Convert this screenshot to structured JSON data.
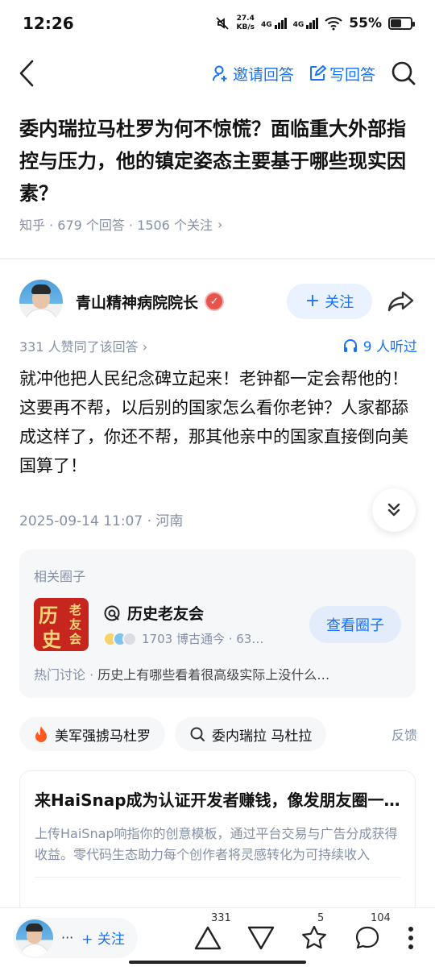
{
  "status": {
    "time": "12:26",
    "speed_value": "27.4",
    "speed_unit": "KB/s",
    "net1": "4G",
    "net2": "4G",
    "battery": "55%",
    "battery_level": 0.55
  },
  "nav": {
    "invite_label": "邀请回答",
    "write_label": "写回答"
  },
  "question": {
    "title": "委内瑞拉马杜罗为何不惊慌？面临重大外部指控与压力，他的镇定姿态主要基于哪些现实因素？",
    "meta": "知乎 · 679 个回答 · 1506 个关注",
    "meta_arrow": "›"
  },
  "author": {
    "name": "青山精神病院院长",
    "follow_label": "关注",
    "agree_text": "331 人赞同了该回答",
    "agree_arrow": "›",
    "listened": "9 人听过"
  },
  "answer": {
    "text": "就冲他把人民纪念碑立起来！老钟都一定会帮他的！这要再不帮，以后别的国家怎么看你老钟？人家都舔成这样了，你还不帮，那其他亲中的国家直接倒向美国算了！",
    "meta": "2025-09-14 11:07 · 河南"
  },
  "circle": {
    "heading": "相关圈子",
    "name": "历史老友会",
    "members": "1703 博古通今 · 63…",
    "view_label": "查看圈子",
    "hot_label": "热门讨论 · ",
    "hot_text": "历史上有哪些看着很高级实际上没什么…",
    "logo_chars": [
      "历",
      "史",
      "老",
      "友",
      "会"
    ]
  },
  "tags": {
    "tag1": "美军强掳马杜罗",
    "tag2": "委内瑞拉 马杜拉",
    "feedback": "反馈"
  },
  "ad": {
    "title": "来HaiSnap成为认证开发者赚钱，像发朋友圈一样简单",
    "desc": "上传HaiSnap响指你的创意模板，通过平台交易与广告分成获得收益。零代码生态助力每个创作者将灵感转化为可持续收入"
  },
  "bottom": {
    "dots": "···",
    "follow_label": "+ 关注",
    "agree_count": "331",
    "favorite_count": "5",
    "comment_count": "104"
  },
  "colors": {
    "accent": "#1772f6",
    "muted": "#8590a6",
    "badge_red": "#e9534e",
    "hot_orange": "#ff5a1f"
  }
}
